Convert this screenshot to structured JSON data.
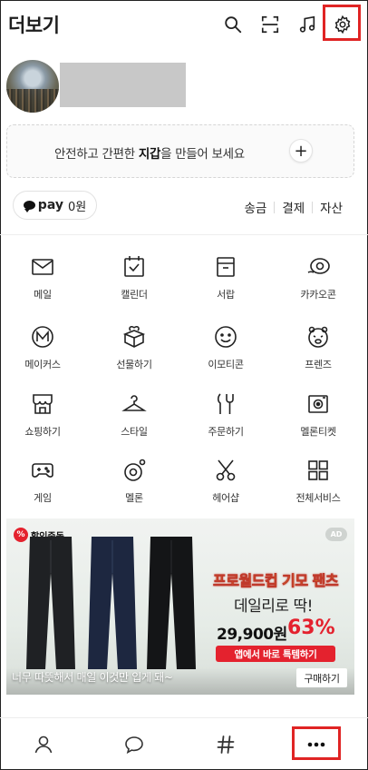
{
  "header": {
    "title": "더보기",
    "icons": [
      "search-icon",
      "scan-icon",
      "music-icon",
      "gear-icon"
    ]
  },
  "wallet": {
    "text_pre": "안전하고 간편한 ",
    "text_bold": "지갑",
    "text_post": "을 만들어 보세요",
    "plus": "+"
  },
  "pay": {
    "logo": "pay",
    "amount": "0원",
    "links": [
      "송금",
      "결제",
      "자산"
    ]
  },
  "grid": [
    {
      "label": "메일",
      "icon": "mail-icon"
    },
    {
      "label": "캘린더",
      "icon": "calendar-icon"
    },
    {
      "label": "서랍",
      "icon": "drawer-icon"
    },
    {
      "label": "카카오콘",
      "icon": "kakaocon-icon"
    },
    {
      "label": "메이커스",
      "icon": "makers-icon"
    },
    {
      "label": "선물하기",
      "icon": "gift-icon"
    },
    {
      "label": "이모티콘",
      "icon": "emoticon-icon"
    },
    {
      "label": "프렌즈",
      "icon": "friends-icon"
    },
    {
      "label": "쇼핑하기",
      "icon": "shop-icon"
    },
    {
      "label": "스타일",
      "icon": "hanger-icon"
    },
    {
      "label": "주문하기",
      "icon": "order-icon"
    },
    {
      "label": "멜론티켓",
      "icon": "ticket-icon"
    },
    {
      "label": "게임",
      "icon": "gamepad-icon"
    },
    {
      "label": "멜론",
      "icon": "melon-icon"
    },
    {
      "label": "헤어샵",
      "icon": "scissors-icon"
    },
    {
      "label": "전체서비스",
      "icon": "all-services-icon"
    }
  ],
  "ad": {
    "badge": "할인중독",
    "tag": "AD",
    "headline": "프로월드컵 기모 팬츠",
    "subline": "데일리로 딱!",
    "price": "29,900원",
    "discount": "63%",
    "cta": "앱에서 바로 특템하기",
    "caption": "너무 따뜻해서 매일 이것만 입게 돼~",
    "buy": "구매하기"
  },
  "bottom_nav": [
    "person-icon",
    "chat-bubble-icon",
    "hashtag-icon",
    "more-dots-icon"
  ],
  "colors": {
    "highlight_box": "#e02424",
    "discount_red": "#e4222e"
  }
}
